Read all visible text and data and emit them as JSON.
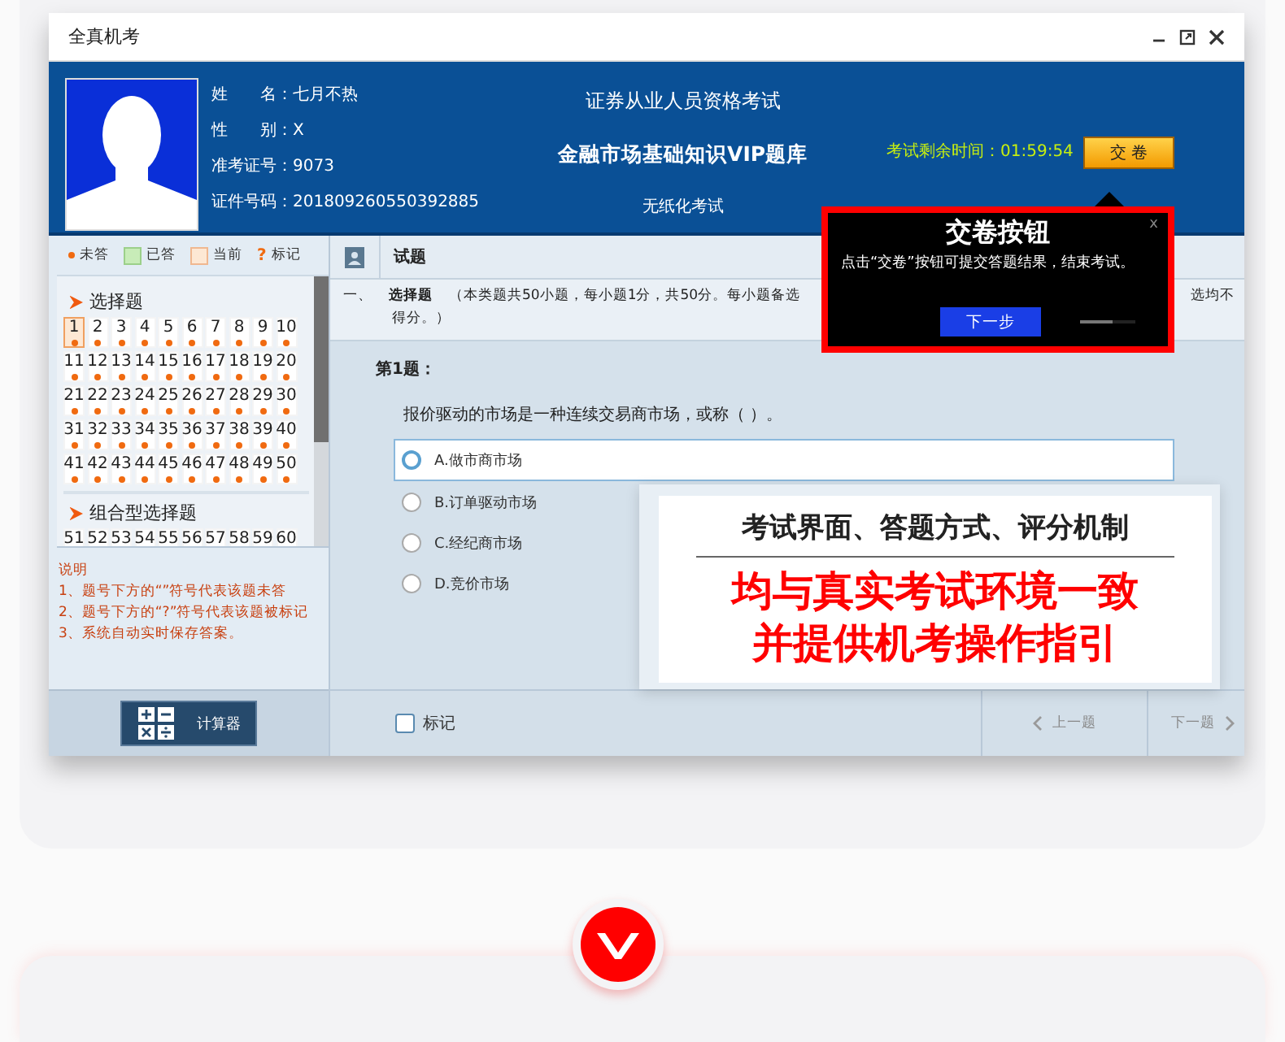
{
  "window": {
    "title": "全真机考"
  },
  "candidate": {
    "lines": [
      "姓　　名：七月不热",
      "性　　别：X",
      "准考证号：9073",
      "证件号码：201809260550392885"
    ]
  },
  "exam": {
    "title": "证券从业人员资格考试",
    "subject": "金融市场基础知识VIP题库",
    "mode": "无纸化考试"
  },
  "timer": "考试剩余时间：01:59:54",
  "submit_button": "交 卷",
  "tooltip": {
    "title": "交卷按钮",
    "close": "x",
    "text": "点击“交卷”按钮可提交答题结果，结束考试。",
    "next_button": "下一步",
    "level": 0.6
  },
  "legend": [
    {
      "kind": "dot",
      "label": "未答"
    },
    {
      "kind": "answered",
      "label": "已答"
    },
    {
      "kind": "current",
      "label": "当前"
    },
    {
      "kind": "mark",
      "symbol": "?",
      "label": "标记"
    }
  ],
  "sections": [
    {
      "title": "选择题",
      "questions": [
        {
          "number": "1",
          "selected": true,
          "unanswered": true
        },
        {
          "number": "2",
          "selected": false,
          "unanswered": true
        },
        {
          "number": "3",
          "selected": false,
          "unanswered": true
        },
        {
          "number": "4",
          "selected": false,
          "unanswered": true
        },
        {
          "number": "5",
          "selected": false,
          "unanswered": true
        },
        {
          "number": "6",
          "selected": false,
          "unanswered": true
        },
        {
          "number": "7",
          "selected": false,
          "unanswered": true
        },
        {
          "number": "8",
          "selected": false,
          "unanswered": true
        },
        {
          "number": "9",
          "selected": false,
          "unanswered": true
        },
        {
          "number": "10",
          "selected": false,
          "unanswered": true
        },
        {
          "number": "11",
          "selected": false,
          "unanswered": true
        },
        {
          "number": "12",
          "selected": false,
          "unanswered": true
        },
        {
          "number": "13",
          "selected": false,
          "unanswered": true
        },
        {
          "number": "14",
          "selected": false,
          "unanswered": true
        },
        {
          "number": "15",
          "selected": false,
          "unanswered": true
        },
        {
          "number": "16",
          "selected": false,
          "unanswered": true
        },
        {
          "number": "17",
          "selected": false,
          "unanswered": true
        },
        {
          "number": "18",
          "selected": false,
          "unanswered": true
        },
        {
          "number": "19",
          "selected": false,
          "unanswered": true
        },
        {
          "number": "20",
          "selected": false,
          "unanswered": true
        },
        {
          "number": "21",
          "selected": false,
          "unanswered": true
        },
        {
          "number": "22",
          "selected": false,
          "unanswered": true
        },
        {
          "number": "23",
          "selected": false,
          "unanswered": true
        },
        {
          "number": "24",
          "selected": false,
          "unanswered": true
        },
        {
          "number": "25",
          "selected": false,
          "unanswered": true
        },
        {
          "number": "26",
          "selected": false,
          "unanswered": true
        },
        {
          "number": "27",
          "selected": false,
          "unanswered": true
        },
        {
          "number": "28",
          "selected": false,
          "unanswered": true
        },
        {
          "number": "29",
          "selected": false,
          "unanswered": true
        },
        {
          "number": "30",
          "selected": false,
          "unanswered": true
        },
        {
          "number": "31",
          "selected": false,
          "unanswered": true
        },
        {
          "number": "32",
          "selected": false,
          "unanswered": true
        },
        {
          "number": "33",
          "selected": false,
          "unanswered": true
        },
        {
          "number": "34",
          "selected": false,
          "unanswered": true
        },
        {
          "number": "35",
          "selected": false,
          "unanswered": true
        },
        {
          "number": "36",
          "selected": false,
          "unanswered": true
        },
        {
          "number": "37",
          "selected": false,
          "unanswered": true
        },
        {
          "number": "38",
          "selected": false,
          "unanswered": true
        },
        {
          "number": "39",
          "selected": false,
          "unanswered": true
        },
        {
          "number": "40",
          "selected": false,
          "unanswered": true
        },
        {
          "number": "41",
          "selected": false,
          "unanswered": true
        },
        {
          "number": "42",
          "selected": false,
          "unanswered": true
        },
        {
          "number": "43",
          "selected": false,
          "unanswered": true
        },
        {
          "number": "44",
          "selected": false,
          "unanswered": true
        },
        {
          "number": "45",
          "selected": false,
          "unanswered": true
        },
        {
          "number": "46",
          "selected": false,
          "unanswered": true
        },
        {
          "number": "47",
          "selected": false,
          "unanswered": true
        },
        {
          "number": "48",
          "selected": false,
          "unanswered": true
        },
        {
          "number": "49",
          "selected": false,
          "unanswered": true
        },
        {
          "number": "50",
          "selected": false,
          "unanswered": true
        }
      ]
    },
    {
      "title": "组合型选择题",
      "questions": [
        {
          "number": "51",
          "selected": false
        },
        {
          "number": "52",
          "selected": false
        },
        {
          "number": "53",
          "selected": false
        },
        {
          "number": "54",
          "selected": false
        },
        {
          "number": "55",
          "selected": false
        },
        {
          "number": "56",
          "selected": false
        },
        {
          "number": "57",
          "selected": false
        },
        {
          "number": "58",
          "selected": false
        },
        {
          "number": "59",
          "selected": false
        },
        {
          "number": "60",
          "selected": false
        }
      ]
    }
  ],
  "notes": {
    "title": "说明",
    "lines": [
      "1、题号下方的“”符号代表该题未答",
      "2、题号下方的“?”符号代表该题被标记",
      "3、系统自动实时保存答案。"
    ]
  },
  "calculator_button": "计算器",
  "question_panel": {
    "header": "试题",
    "section_number": "一、",
    "section_name": "选择题",
    "description": "（本类题共50小题，每小题1分，共50分。每小题备选",
    "description_tail": "选均不",
    "description_line2": "得分。）",
    "question_title": "第1题：",
    "stem": "报价驱动的市场是一种连续交易商市场，或称（ ）。",
    "options": [
      {
        "label": "A.做市商市场",
        "selected": false,
        "highlighted": true
      },
      {
        "label": "B.订单驱动市场",
        "selected": false,
        "highlighted": false
      },
      {
        "label": "C.经纪商市场",
        "selected": false,
        "highlighted": false
      },
      {
        "label": "D.竞价市场",
        "selected": false,
        "highlighted": false
      }
    ]
  },
  "mark_checkbox": {
    "label": "标记",
    "checked": false
  },
  "prev_button": "上一题",
  "next_button": "下一题",
  "promo": {
    "subtitle": "考试界面、答题方式、评分机制",
    "lines": [
      "均与真实考试环境一致",
      "并提供机考操作指引"
    ]
  }
}
